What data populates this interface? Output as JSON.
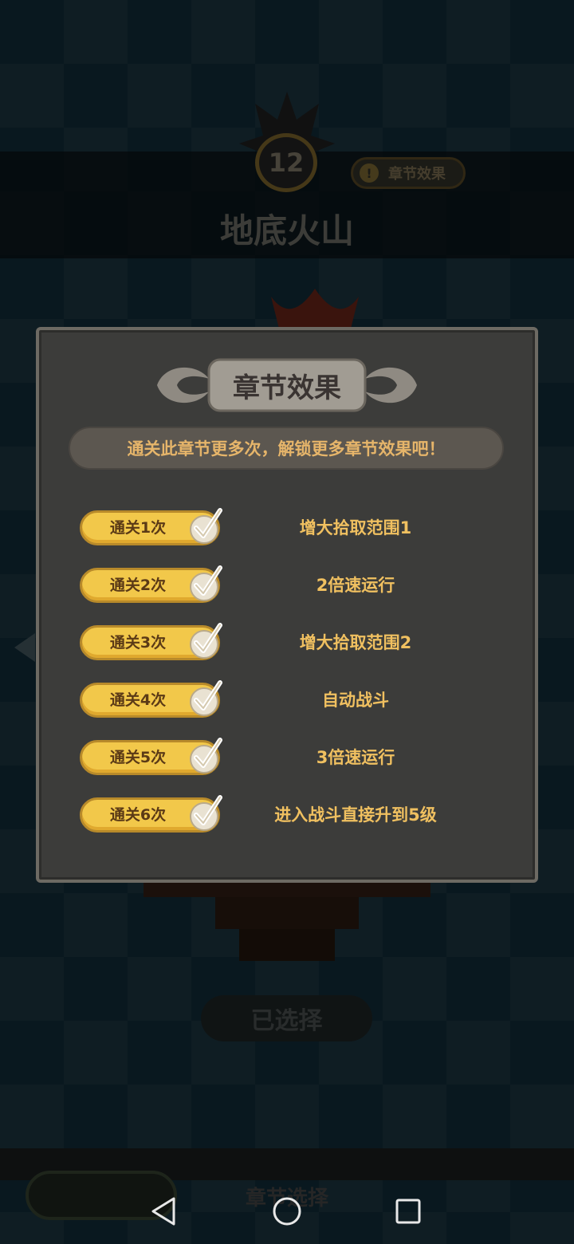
{
  "header": {
    "chapter_number": "12",
    "effect_button_label": "章节效果",
    "chapter_name": "地底火山"
  },
  "modal": {
    "title": "章节效果",
    "hint": "通关此章节更多次，解锁更多章节效果吧！",
    "rows": [
      {
        "requirement": "通关1次",
        "effect": "增大拾取范围1",
        "completed": true
      },
      {
        "requirement": "通关2次",
        "effect": "2倍速运行",
        "completed": true
      },
      {
        "requirement": "通关3次",
        "effect": "增大拾取范围2",
        "completed": true
      },
      {
        "requirement": "通关4次",
        "effect": "自动战斗",
        "completed": true
      },
      {
        "requirement": "通关5次",
        "effect": "3倍速运行",
        "completed": true
      },
      {
        "requirement": "通关6次",
        "effect": "进入战斗直接升到5级",
        "completed": true
      }
    ]
  },
  "main": {
    "selected_button_label": "已选择"
  },
  "bottom": {
    "chapter_select_label": "章节选择"
  },
  "icons": {
    "check": "check-icon",
    "warning": "exclamation-icon",
    "nav_back": "back-triangle-icon",
    "nav_home": "home-circle-icon",
    "nav_recent": "recent-square-icon"
  },
  "colors": {
    "accent_gold": "#f2c84a",
    "effect_text": "#f0c060",
    "modal_bg": "#3c3c3a"
  }
}
